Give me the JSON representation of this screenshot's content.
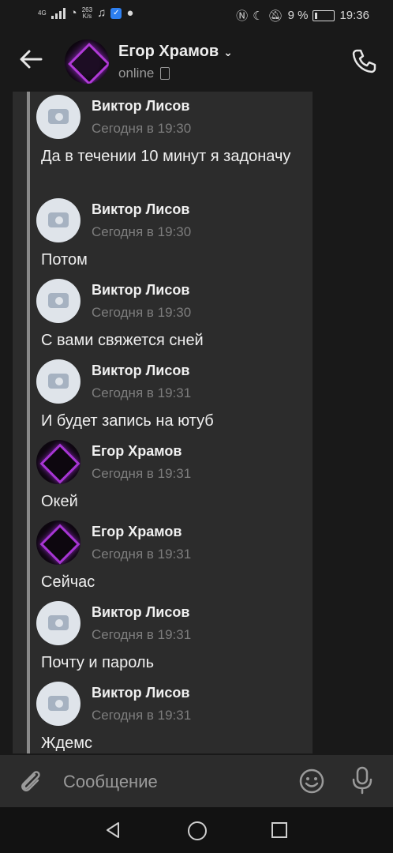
{
  "status": {
    "net_small": "4G",
    "speed": "263",
    "speed_unit": "K/s",
    "battery": "9 %",
    "time": "19:36"
  },
  "header": {
    "title": "Егор Храмов",
    "subtitle": "online"
  },
  "messages": [
    {
      "author": "Виктор Лисов",
      "time": "Сегодня в 19:30",
      "text": "Да в течении 10 минут я задоначу",
      "avatar": "camera-placeholder"
    },
    {
      "author": "Виктор Лисов",
      "time": "Сегодня в 19:30",
      "text": "Потом",
      "avatar": "camera-placeholder"
    },
    {
      "author": "Виктор Лисов",
      "time": "Сегодня в 19:30",
      "text": "С вами свяжется сней",
      "avatar": "camera-placeholder"
    },
    {
      "author": "Виктор Лисов",
      "time": "Сегодня в 19:31",
      "text": "И будет запись на ютуб",
      "avatar": "camera-placeholder"
    },
    {
      "author": "Егор Храмов",
      "time": "Сегодня в 19:31",
      "text": "Окей",
      "avatar": "purple-diamond"
    },
    {
      "author": "Егор Храмов",
      "time": "Сегодня в 19:31",
      "text": "Сейчас",
      "avatar": "purple-diamond"
    },
    {
      "author": "Виктор Лисов",
      "time": "Сегодня в 19:31",
      "text": "Почту и пароль",
      "avatar": "camera-placeholder"
    },
    {
      "author": "Виктор Лисов",
      "time": "Сегодня в 19:31",
      "text": "Ждемс",
      "avatar": "camera-placeholder"
    }
  ],
  "composer": {
    "placeholder": "Сообщение"
  }
}
